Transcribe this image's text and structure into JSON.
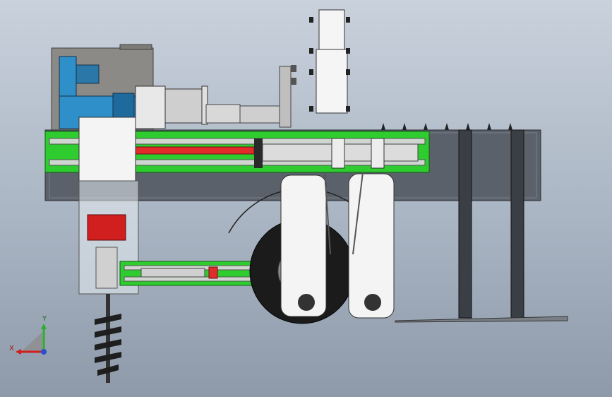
{
  "triad": {
    "x_label": "X",
    "y_label": "Y"
  },
  "colors": {
    "background_top": "#c9d1dc",
    "background_bottom": "#8e9aa9",
    "frame_green": "#2ecc2e",
    "frame_dark": "#555b63",
    "motor_blue": "#2f8fc8",
    "cylinder_red": "#e22c2c",
    "tire_black": "#1b1b1b"
  }
}
